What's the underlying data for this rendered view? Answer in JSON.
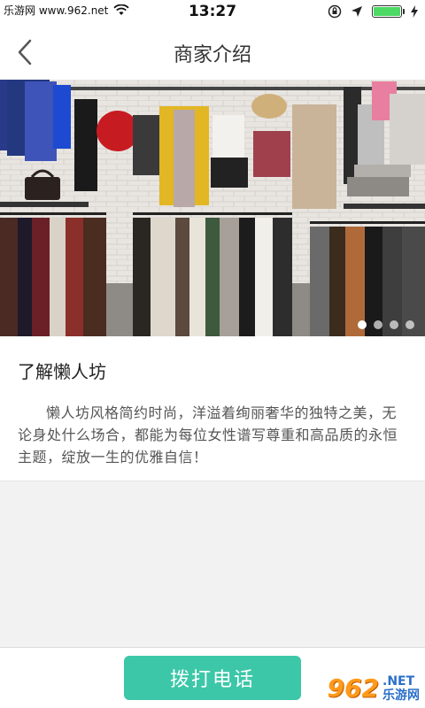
{
  "status_bar": {
    "carrier": "乐游网 www.962.net",
    "time": "13:27",
    "battery_level": 1.0,
    "colors": {
      "battery": "#4cd964"
    }
  },
  "nav": {
    "title": "商家介绍",
    "back_icon": "chevron-left-icon"
  },
  "banner": {
    "slide_count": 4,
    "active_slide": 1
  },
  "intro": {
    "title": "了解懒人坊",
    "body": "懒人坊风格简约时尚，洋溢着绚丽奢华的独特之美，无论身处什么场合，都能为每位女性谱写尊重和高品质的永恒主题，绽放一生的优雅自信！"
  },
  "bottom": {
    "call_label": "拨打电话",
    "accent": "#3cc7a8"
  },
  "watermark": {
    "number": "962",
    "suffix": ".NET",
    "site": "乐游网"
  }
}
